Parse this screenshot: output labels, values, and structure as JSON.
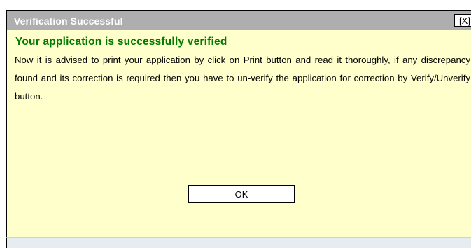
{
  "dialog": {
    "title": "Verification Successful",
    "close_label": "[X]",
    "heading": "Your application is successfully verified",
    "message": "Now it is advised to print your application by click on Print button and read it thoroughly, if any discrepancy found and its correction is required then you have to un-verify the application for correction by Verify/Unverify button.",
    "ok_label": "OK"
  },
  "colors": {
    "titlebar_bg": "#aeaeae",
    "dialog_bg": "#ffffcc",
    "heading_text": "#007a00",
    "title_text": "#ffffff"
  }
}
